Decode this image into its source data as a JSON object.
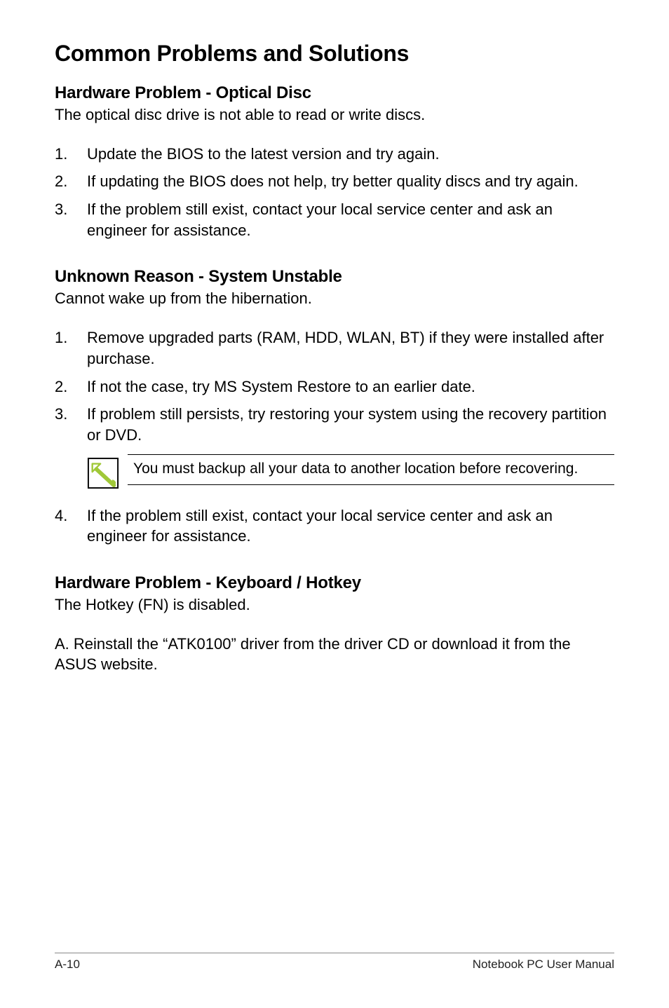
{
  "main_heading": "Common Problems and Solutions",
  "sections": {
    "s1": {
      "heading": "Hardware Problem - Optical Disc",
      "intro": "The optical disc drive is not able to read or write discs.",
      "items": {
        "i1": {
          "num": "1.",
          "text": "Update the BIOS to the latest version and try again."
        },
        "i2": {
          "num": "2.",
          "text": "If updating the BIOS does not help, try better quality discs and try again."
        },
        "i3": {
          "num": "3.",
          "text": "If the problem still exist, contact your local service center and ask an engineer for assistance."
        }
      }
    },
    "s2": {
      "heading": "Unknown Reason - System Unstable",
      "intro": "Cannot wake up from the hibernation.",
      "items": {
        "i1": {
          "num": "1.",
          "text": "Remove upgraded parts (RAM, HDD, WLAN, BT) if they were installed after purchase."
        },
        "i2": {
          "num": "2.",
          "text": "If not the case, try MS System Restore to an earlier date."
        },
        "i3": {
          "num": "3.",
          "text": "If problem still persists, try restoring your system using the recovery partition or DVD."
        },
        "i4": {
          "num": "4.",
          "text": "If the problem still exist, contact your local service center and ask an engineer for assistance."
        }
      },
      "note": "You must backup all your data to another location before recovering."
    },
    "s3": {
      "heading": "Hardware Problem - Keyboard / Hotkey",
      "intro": "The Hotkey (FN) is disabled.",
      "body": "A. Reinstall the “ATK0100” driver from the driver CD or download it from the ASUS website."
    }
  },
  "footer": {
    "left": "A-10",
    "right": "Notebook PC User Manual"
  }
}
